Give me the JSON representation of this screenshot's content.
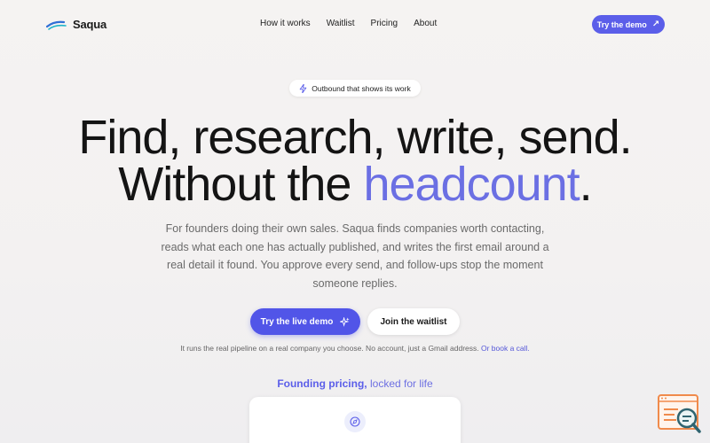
{
  "brand": {
    "name": "Saqua",
    "logo_icon": "wave-logo-icon"
  },
  "nav": {
    "items": [
      {
        "label": "How it works"
      },
      {
        "label": "Waitlist"
      },
      {
        "label": "Pricing"
      },
      {
        "label": "About"
      }
    ]
  },
  "header_cta": {
    "label": "Try the demo",
    "icon": "arrow-up-right-icon"
  },
  "pill": {
    "label": "Outbound that shows its work",
    "icon": "bolt-icon"
  },
  "hero": {
    "line1": "Find, research, write, send.",
    "line2_prefix": "Without the ",
    "line2_accent": "headcount",
    "line2_suffix": "."
  },
  "subtext": "For founders doing their own sales. Saqua finds companies worth contacting, reads what each one has actually published, and writes the first email around a real detail it found. You approve every send, and follow-ups stop the moment someone replies.",
  "buttons": {
    "primary": {
      "label": "Try the live demo",
      "icon": "sparkle-icon"
    },
    "secondary": {
      "label": "Join the waitlist"
    }
  },
  "note": {
    "text": "It runs the real pipeline on a real company you choose. No account, just a Gmail address. ",
    "link": "Or book a call."
  },
  "pricing": {
    "heading_strong": "Founding pricing,",
    "heading_light": " locked for life",
    "card_icon": "compass-icon"
  },
  "colors": {
    "accent": "#5b5ee9",
    "accent_text": "#6b6fe3",
    "background": "#f4f2f1"
  }
}
